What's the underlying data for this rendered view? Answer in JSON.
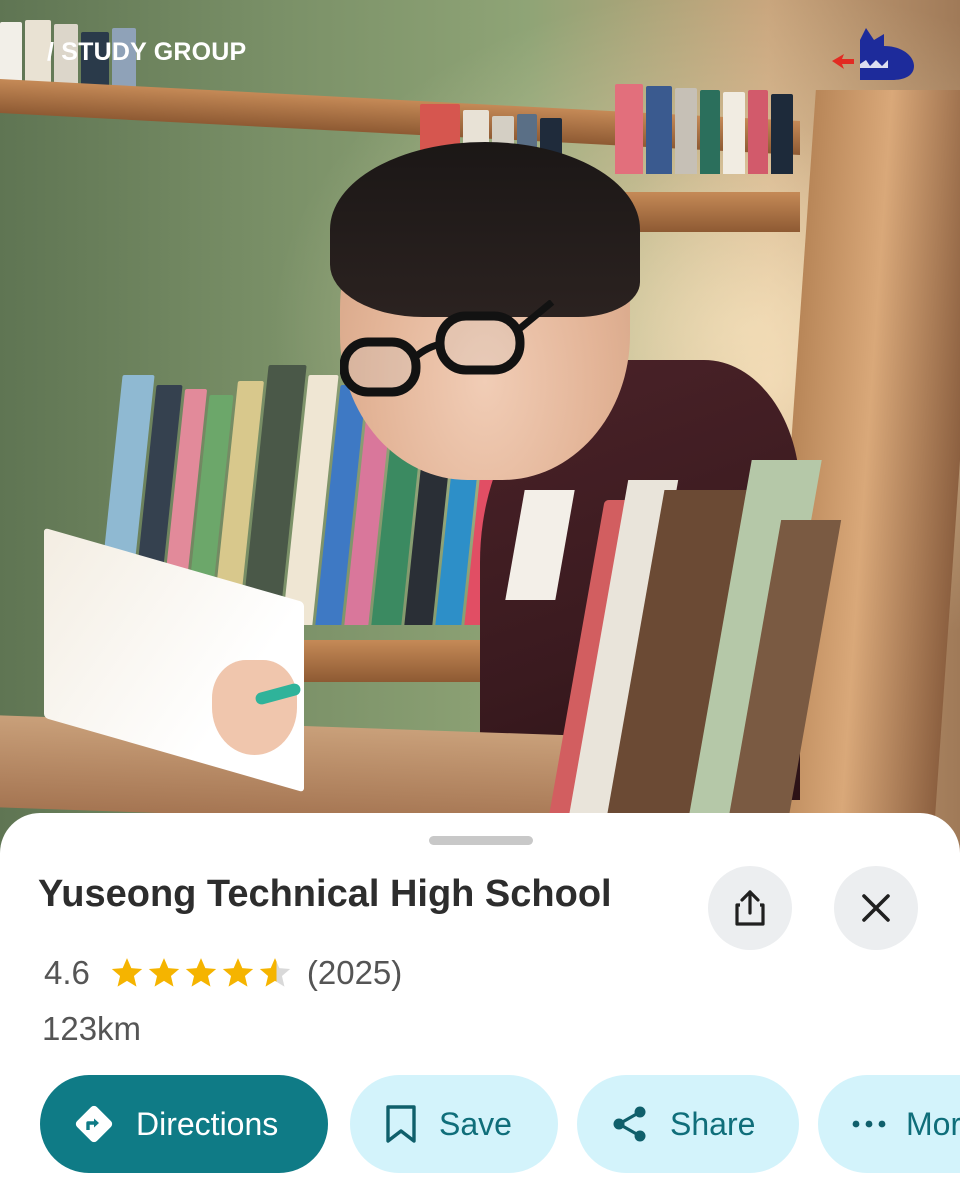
{
  "header": {
    "brand_label": "/ STUDY GROUP",
    "logo_icon": "blue-wolf-head-logo",
    "accent_red": "#e22b22",
    "logo_blue": "#1d2b9b"
  },
  "place": {
    "name": "Yuseong Technical High School",
    "rating": "4.6",
    "stars_value": 4.6,
    "review_count": "(2025)",
    "distance": "123km"
  },
  "actions": {
    "directions_label": "Directions",
    "save_label": "Save",
    "share_label": "Share",
    "more_label": "More"
  },
  "icons": {
    "share_top": "share-upload-icon",
    "close": "close-icon",
    "directions": "directions-diamond-icon",
    "save": "bookmark-icon",
    "share": "share-nodes-icon",
    "more": "more-dots-icon",
    "star": "star-icon"
  },
  "colors": {
    "primary": "#0f7b86",
    "secondary_bg": "#d3f3fb",
    "secondary_text": "#0f6e7a",
    "star": "#f5b400",
    "title_text": "#2d2d2d",
    "meta_text": "#555555"
  }
}
